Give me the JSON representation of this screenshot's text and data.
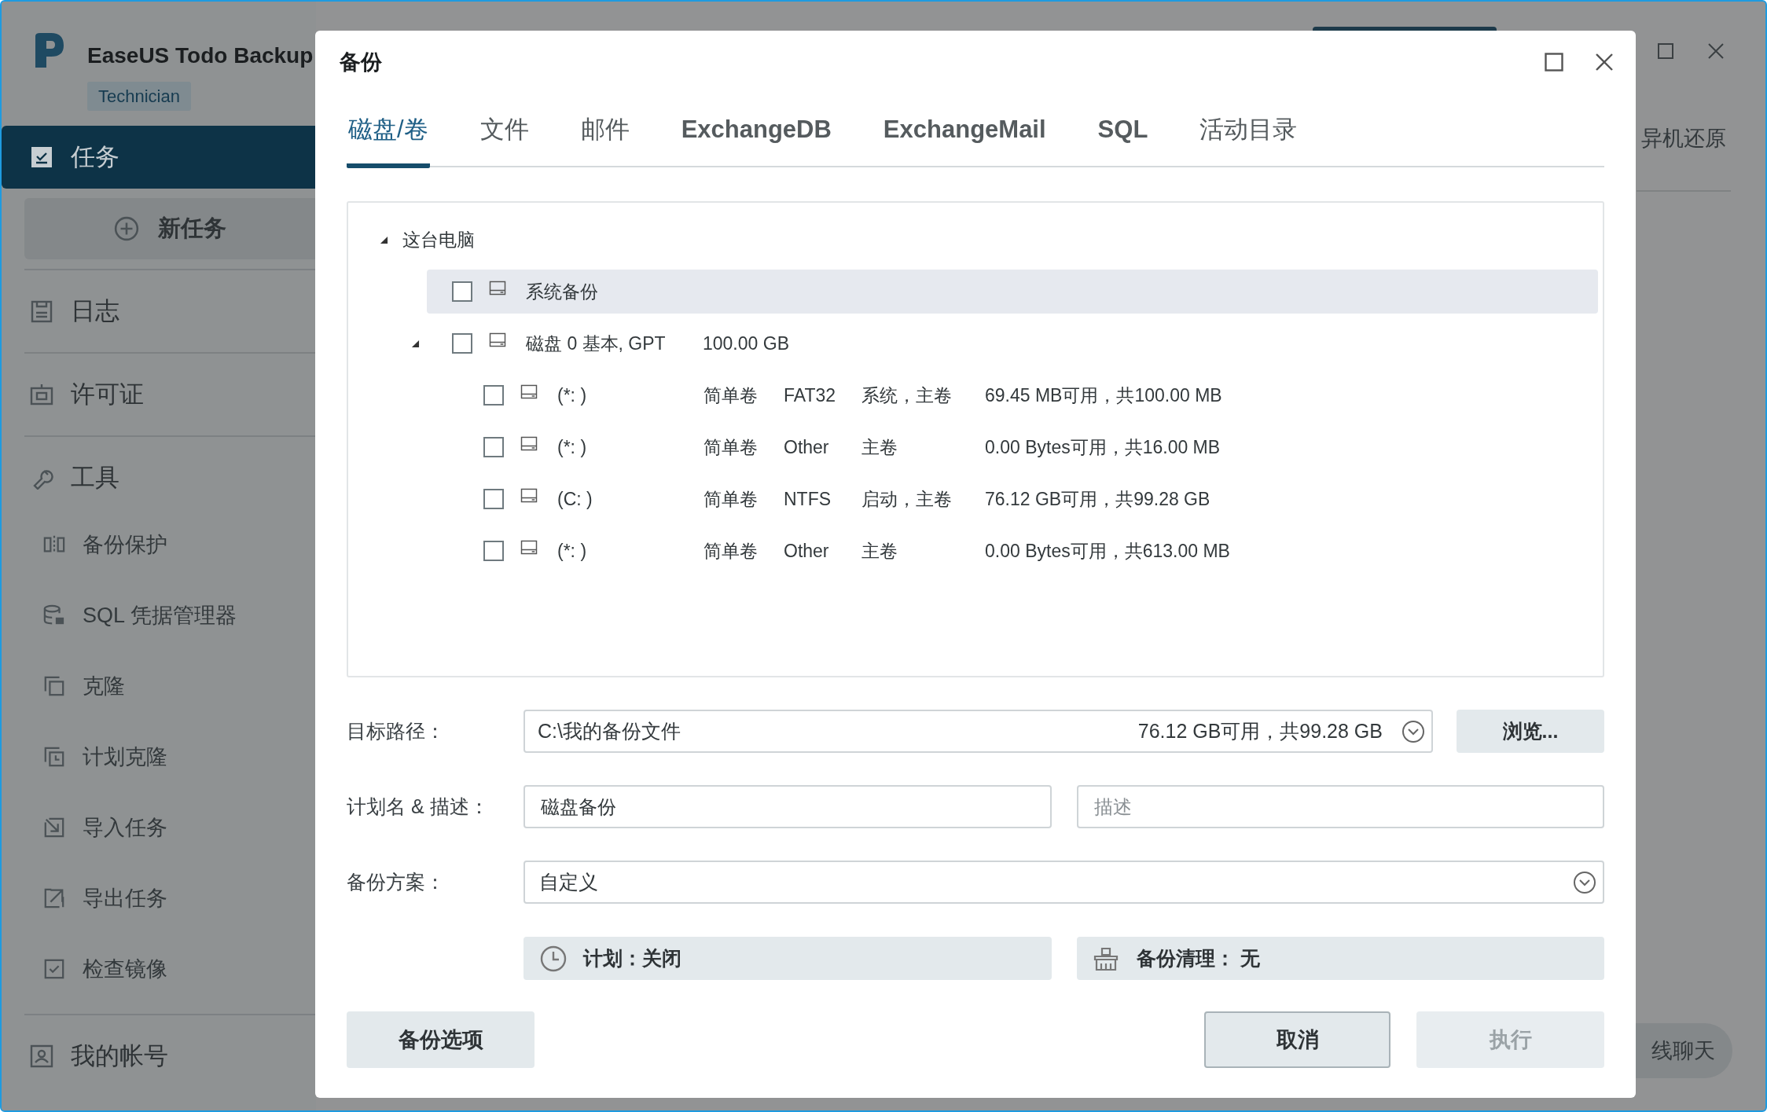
{
  "app": {
    "title": "EaseUS Todo Backup",
    "edition": "Technician"
  },
  "sidebar": {
    "items": [
      {
        "kind": "section",
        "label": "任务",
        "selected": true
      },
      {
        "kind": "action",
        "label": "新任务"
      },
      {
        "kind": "section",
        "label": "日志",
        "selected": false
      },
      {
        "kind": "section",
        "label": "许可证",
        "selected": false
      },
      {
        "kind": "section",
        "label": "工具",
        "selected": false
      },
      {
        "kind": "tool",
        "label": "备份保护"
      },
      {
        "kind": "tool",
        "label": "SQL 凭据管理器"
      },
      {
        "kind": "tool",
        "label": "克隆"
      },
      {
        "kind": "tool",
        "label": "计划克隆"
      },
      {
        "kind": "tool",
        "label": "导入任务"
      },
      {
        "kind": "tool",
        "label": "导出任务"
      },
      {
        "kind": "tool",
        "label": "检查镜像"
      },
      {
        "kind": "section",
        "label": "我的帐号",
        "selected": false
      }
    ]
  },
  "background": {
    "side_link": "异机还原",
    "chat_button": "线聊天"
  },
  "dialog": {
    "title": "备份",
    "tabs": [
      {
        "label": "磁盘/卷",
        "selected": true
      },
      {
        "label": "文件",
        "selected": false
      },
      {
        "label": "邮件",
        "selected": false
      },
      {
        "label": "ExchangeDB",
        "selected": false
      },
      {
        "label": "ExchangeMail",
        "selected": false
      },
      {
        "label": "SQL",
        "selected": false
      },
      {
        "label": "活动目录",
        "selected": false
      }
    ],
    "tree": [
      {
        "label": "这台电脑",
        "expanded": true,
        "children": [
          {
            "label": "系统备份",
            "checked": false,
            "selected": true
          },
          {
            "label": "磁盘 0 基本, GPT",
            "size": "100.00 GB",
            "checked": false,
            "selected": false,
            "expanded": true,
            "children": [
              {
                "label": "(*: )",
                "type": "简单卷",
                "fs": "FAT32",
                "flags": "系统，主卷",
                "space": "69.45 MB可用，共100.00 MB",
                "checked": false,
                "selected": false
              },
              {
                "label": "(*: )",
                "type": "简单卷",
                "fs": "Other",
                "flags": "主卷",
                "space": "0.00 Bytes可用，共16.00 MB",
                "checked": false,
                "selected": false
              },
              {
                "label": "(C: )",
                "type": "简单卷",
                "fs": "NTFS",
                "flags": "启动，主卷",
                "space": "76.12 GB可用，共99.28 GB",
                "checked": false,
                "selected": false
              },
              {
                "label": "(*: )",
                "type": "简单卷",
                "fs": "Other",
                "flags": "主卷",
                "space": "0.00 Bytes可用，共613.00 MB",
                "checked": false,
                "selected": false
              }
            ]
          }
        ]
      }
    ],
    "target": {
      "label": "目标路径：",
      "value": "C:\\我的备份文件",
      "space": "76.12 GB可用，共99.28 GB",
      "browse": "浏览..."
    },
    "plan": {
      "label": "计划名 & 描述：",
      "name": "磁盘备份",
      "description_placeholder": "描述"
    },
    "scheme": {
      "label": "备份方案：",
      "value": "自定义"
    },
    "schedule": "计划：关闭",
    "cleanup": "备份清理： 无",
    "buttons": [
      {
        "kind": "options",
        "label": "备份选项",
        "disabled": false
      },
      {
        "kind": "cancel",
        "label": "取消",
        "disabled": false
      },
      {
        "kind": "run",
        "label": "执行",
        "disabled": true
      }
    ]
  }
}
